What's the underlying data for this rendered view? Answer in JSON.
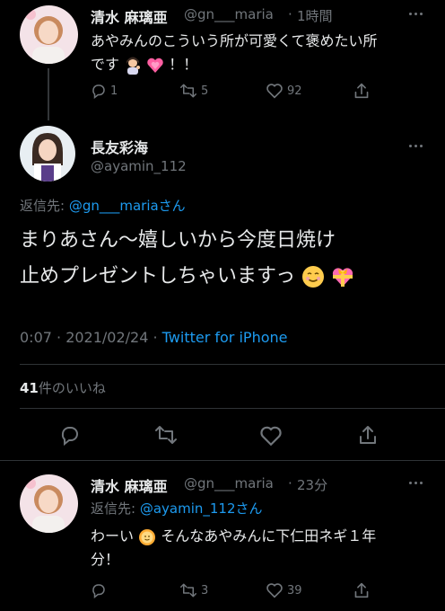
{
  "tweet1": {
    "name": "清水 麻璃亜",
    "handle": "@gn___maria",
    "time": "1時間",
    "text_line1": "あやみんのこういう所が可愛くて褒めたい所",
    "text_line2_pre": "です",
    "text_line2_post": "！！",
    "emoji": [
      "woman-tipping-hand-icon",
      "growing-heart-icon"
    ],
    "replies": "1",
    "retweets": "5",
    "likes": "92"
  },
  "tweet2": {
    "name": "長友彩海",
    "handle": "@ayamin_112",
    "reply_prefix": "返信先: ",
    "reply_to": "@gn___mariaさん",
    "text_line1": "まりあさん〜嬉しいから今度日焼け",
    "text_line2": "止めプレゼントしちゃいますっ",
    "emoji": [
      "smiling-face-icon",
      "heart-with-ribbon-icon"
    ],
    "timestamp": "0:07 · 2021/02/24 · ",
    "client": "Twitter for iPhone",
    "likes_count": "41",
    "likes_label": "件のいいね"
  },
  "tweet3": {
    "name": "清水 麻璃亜",
    "handle": "@gn___maria",
    "time": "23分",
    "reply_prefix": "返信先: ",
    "reply_to": "@ayamin_112さん",
    "text_line1_pre": "わーい",
    "text_line1_post": "そんなあやみんに下仁田ネギ１年",
    "text_line2": "分！",
    "emoji": [
      "sun-with-face-icon"
    ],
    "replies": "",
    "retweets": "3",
    "likes": "39"
  },
  "colors": {
    "background": "#000000",
    "text": "#e7e9ea",
    "muted": "#71767b",
    "link": "#1d9bf0",
    "divider": "#2f3336"
  }
}
